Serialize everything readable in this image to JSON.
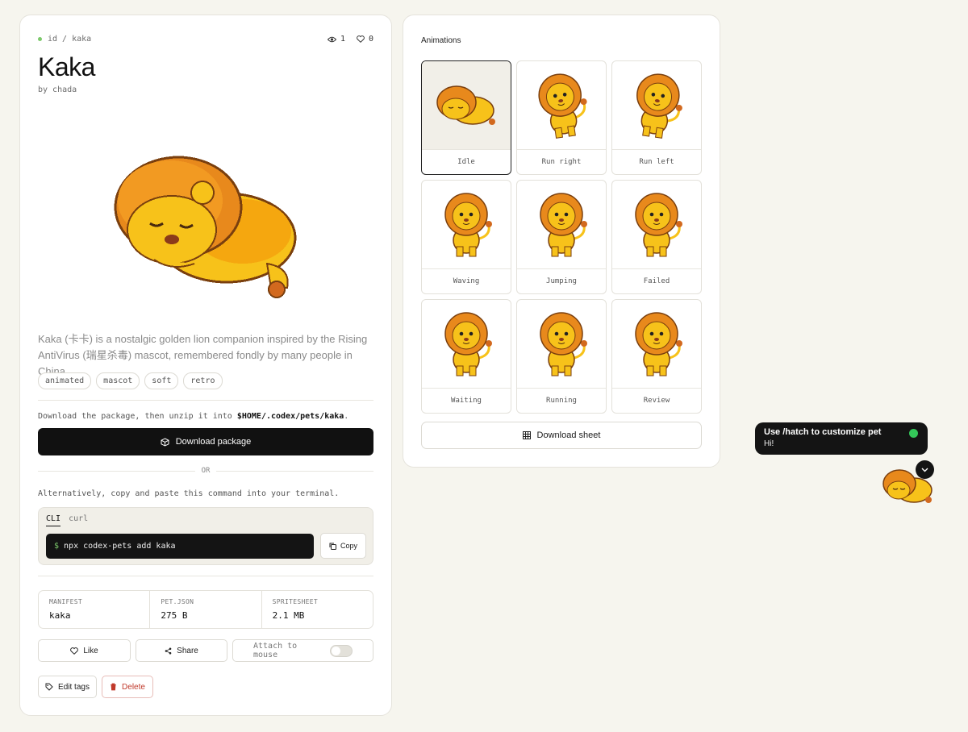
{
  "pet": {
    "breadcrumb": "id / kaka",
    "views": "1",
    "likes": "0",
    "name": "Kaka",
    "byline": "by chada",
    "description": "Kaka (卡卡) is a nostalgic golden lion companion inspired by the Rising AntiVirus (瑞星杀毒) mascot, remembered fondly by many people in China.",
    "tags": [
      "animated",
      "mascot",
      "soft",
      "retro"
    ]
  },
  "download": {
    "instruction_prefix": "Download the package, then unzip it into ",
    "instruction_path": "$HOME/.codex/pets/kaka",
    "instruction_suffix": ".",
    "button_label": "Download package",
    "or_label": "OR",
    "alt_instruction": "Alternatively, copy and paste this command into your terminal."
  },
  "command": {
    "tabs": [
      "CLI",
      "curl"
    ],
    "active_tab": "CLI",
    "prompt": "$",
    "text": "npx codex-pets add kaka",
    "copy_label": "Copy"
  },
  "meta": [
    {
      "label": "MANIFEST",
      "value": "kaka"
    },
    {
      "label": "PET.JSON",
      "value": "275 B"
    },
    {
      "label": "SPRITESHEET",
      "value": "2.1 MB"
    }
  ],
  "actions": {
    "like": "Like",
    "share": "Share",
    "attach": "Attach to mouse",
    "attach_on": false,
    "edit_tags": "Edit tags",
    "delete": "Delete"
  },
  "animations": {
    "title": "Animations",
    "items": [
      "Idle",
      "Run right",
      "Run left",
      "Waving",
      "Jumping",
      "Failed",
      "Waiting",
      "Running",
      "Review"
    ],
    "selected": "Idle",
    "sheet_button": "Download sheet"
  },
  "toast": {
    "title": "Use /hatch to customize pet",
    "message": "Hi!"
  },
  "colors": {
    "accent_green": "#7cc96b",
    "lion_mane": "#e8891c",
    "lion_body": "#f7c21a",
    "danger": "#c0392b"
  }
}
